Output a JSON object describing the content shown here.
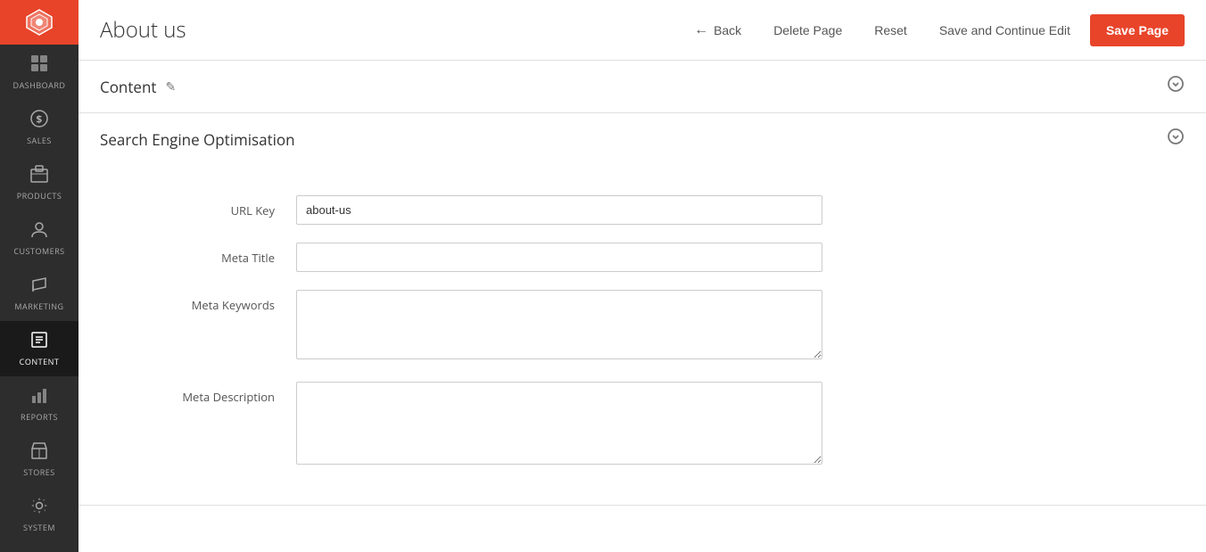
{
  "sidebar": {
    "logo_icon": "◈",
    "items": [
      {
        "id": "dashboard",
        "label": "DASHBOARD",
        "icon": "⊟",
        "active": false
      },
      {
        "id": "sales",
        "label": "SALES",
        "icon": "$",
        "active": false
      },
      {
        "id": "products",
        "label": "PRODUCTS",
        "icon": "⊞",
        "active": false
      },
      {
        "id": "customers",
        "label": "CUSTOMERS",
        "icon": "👤",
        "active": false
      },
      {
        "id": "marketing",
        "label": "MARKETING",
        "icon": "📣",
        "active": false
      },
      {
        "id": "content",
        "label": "CONTENT",
        "icon": "▣",
        "active": true
      },
      {
        "id": "reports",
        "label": "REPORTS",
        "icon": "📊",
        "active": false
      },
      {
        "id": "stores",
        "label": "STORES",
        "icon": "🏪",
        "active": false
      },
      {
        "id": "system",
        "label": "SYSTEM",
        "icon": "⚙",
        "active": false
      }
    ]
  },
  "header": {
    "title": "About us",
    "back_label": "Back",
    "delete_label": "Delete Page",
    "reset_label": "Reset",
    "save_continue_label": "Save and Continue Edit",
    "save_label": "Save Page"
  },
  "content_section": {
    "title": "Content",
    "edit_icon": "✎",
    "chevron_icon": "⌄"
  },
  "seo_section": {
    "title": "Search Engine Optimisation",
    "chevron_icon": "⌄",
    "fields": {
      "url_key_label": "URL Key",
      "url_key_value": "about-us",
      "meta_title_label": "Meta Title",
      "meta_title_value": "",
      "meta_keywords_label": "Meta Keywords",
      "meta_keywords_value": "",
      "meta_description_label": "Meta Description",
      "meta_description_value": ""
    }
  }
}
